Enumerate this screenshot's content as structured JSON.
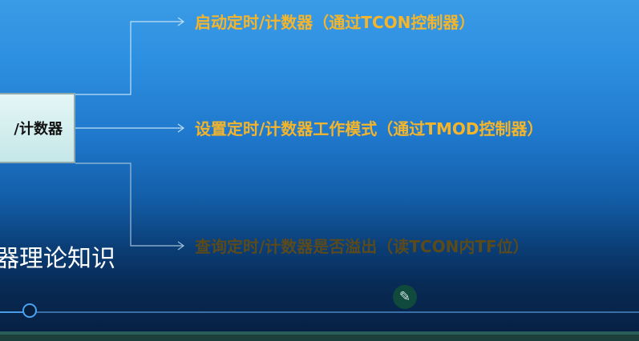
{
  "slide": {
    "center_box_label": "/计数器",
    "heading": "器理论知识",
    "items": [
      {
        "text": "启动定时/计数器（通过TCON控制器）"
      },
      {
        "text": "设置定时/计数器工作模式（通过TMOD控制器）"
      },
      {
        "text": "查询定时/计数器是否溢出（读TCON内TF位）"
      }
    ]
  },
  "controls": {
    "pen_icon": "pencil-icon"
  },
  "colors": {
    "accent_text": "#f5b52b",
    "dim_text": "#5a4a1c",
    "timeline": "#4aa2f0"
  }
}
